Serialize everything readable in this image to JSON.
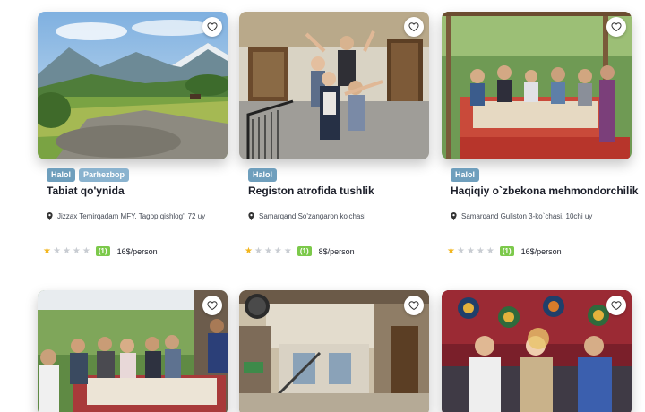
{
  "cards": [
    {
      "tags": [
        "Halol",
        "Parhezbop"
      ],
      "title": "Tabiat qo'ynida",
      "address": "Jizzax Temirqadam MFY, Tagop qishlog'i 72 uy",
      "rating_stars": 1,
      "rating_max": 5,
      "review_count": "(1)",
      "price": "16$/person",
      "icons": {
        "favorite": "heart-outline-icon",
        "location": "map-pin-icon",
        "star": "star-icon"
      }
    },
    {
      "tags": [
        "Halol"
      ],
      "title": "Registon atrofida tushlik",
      "address": "Samarqand So'zangaron ko'chasi",
      "rating_stars": 1,
      "rating_max": 5,
      "review_count": "(1)",
      "price": "8$/person",
      "icons": {
        "favorite": "heart-outline-icon",
        "location": "map-pin-icon",
        "star": "star-icon"
      }
    },
    {
      "tags": [
        "Halol"
      ],
      "title": "Haqiqiy o`zbekona mehmondorchilik",
      "address": "Samarqand Guliston 3-ko`chasi, 10chi uy",
      "rating_stars": 1,
      "rating_max": 5,
      "review_count": "(1)",
      "price": "16$/person",
      "icons": {
        "favorite": "heart-outline-icon",
        "location": "map-pin-icon",
        "star": "star-icon"
      }
    },
    {
      "tags": [],
      "icons": {
        "favorite": "heart-outline-icon"
      }
    },
    {
      "tags": [],
      "icons": {
        "favorite": "heart-outline-icon"
      }
    },
    {
      "tags": [],
      "icons": {
        "favorite": "heart-outline-icon"
      }
    }
  ],
  "colors": {
    "tag_halol": "#6f9fbd",
    "tag_parhezbop": "#8ab3cf",
    "star_active": "#f2b51c",
    "star_inactive": "#c8ccd2",
    "review_badge": "#7cc94b"
  }
}
